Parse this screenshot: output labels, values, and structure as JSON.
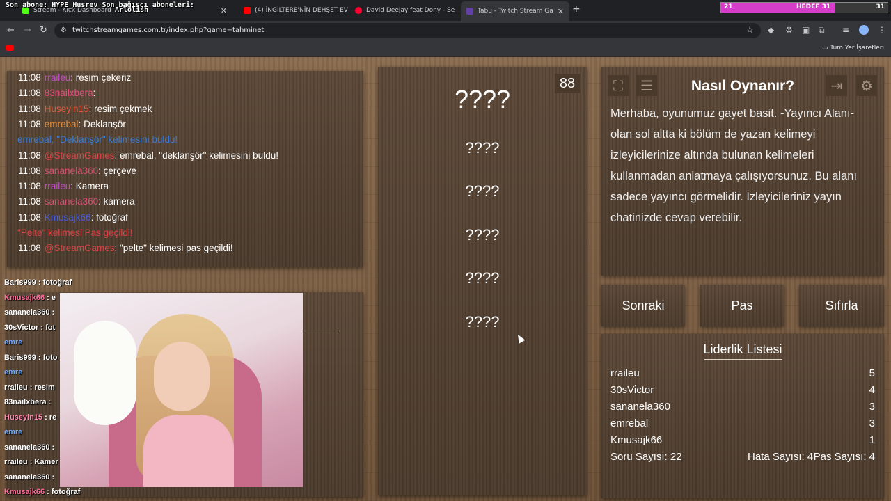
{
  "stream_overlay": {
    "sub_text": "Son abone: HYPE_Husrev Son bağışçı aboneleri:",
    "streamer_name": "Arlolish",
    "goal_left": "21",
    "goal_label": "HEDEF 31",
    "goal_right": "31",
    "goal_progress": 0.68
  },
  "tabs": [
    {
      "label": "Stream - Kick Dashboard",
      "color": "#53fc18"
    },
    {
      "label": "(4) İNGİLTERE'NİN DEHŞET EVİ",
      "color": "#ff0000"
    },
    {
      "label": "David Deejay feat Dony - Se",
      "color": "#ff0000"
    },
    {
      "label": "Tabu - Twitch Stream Game",
      "color": "#6441a5"
    }
  ],
  "address": {
    "url": "twitchstreamgames.com.tr/index.php?game=tahminet"
  },
  "bookmarks": {
    "folder_label": "Tüm Yer İşaretleri"
  },
  "chat": [
    {
      "time": "11:08",
      "user": "rraileu",
      "user_color": "#c34ecb",
      "msg": ": resim çekeriz"
    },
    {
      "time": "11:08",
      "user": "83nailxbera",
      "user_color": "#e74e7f",
      "msg": ":"
    },
    {
      "time": "11:08",
      "user": "Huseyin15",
      "user_color": "#e05a3c",
      "msg": ": resim çekmek"
    },
    {
      "time": "11:08",
      "user": "emrebal",
      "user_color": "#e08c3c",
      "msg": ": Deklanşör"
    },
    {
      "time": "",
      "user": "",
      "user_color": "#3c7bd6",
      "msg": "emrebal, \"Deklanşör\" kelimesini buldu!"
    },
    {
      "time": "11:08",
      "user": "@StreamGames",
      "user_color": "#d94444",
      "msg": ": emrebal, \"deklanşör\" kelimesini buldu!"
    },
    {
      "time": "11:08",
      "user": "sananela360",
      "user_color": "#d64f72",
      "msg": ": çerçeve"
    },
    {
      "time": "11:08",
      "user": "rraileu",
      "user_color": "#c34ecb",
      "msg": ": Kamera"
    },
    {
      "time": "11:08",
      "user": "sananela360",
      "user_color": "#d64f72",
      "msg": ": kamera"
    },
    {
      "time": "11:08",
      "user": "Kmusajk66",
      "user_color": "#4a5ed8",
      "msg": ": fotoğraf"
    },
    {
      "time": "",
      "user": "",
      "user_color": "#d94444",
      "msg": "\"Pelte\" kelimesi Pas geçildi!"
    },
    {
      "time": "11:08",
      "user": "@StreamGames",
      "user_color": "#d94444",
      "msg": ": \"pelte\" kelimesi pas geçildi!"
    }
  ],
  "overlay_chat": [
    {
      "user": "Baris999",
      "user_color": "#ffffff",
      "msg": " : fotoğraf"
    },
    {
      "user": "Kmusajk66",
      "user_color": "#ff6b9a",
      "msg": " : e"
    },
    {
      "user": "sananela360",
      "user_color": "#ffffff",
      "msg": " :"
    },
    {
      "user": "30sVictor",
      "user_color": "#ffffff",
      "msg": " : fot"
    },
    {
      "user": "emre",
      "user_color": "#6fa8ff",
      "msg": ""
    },
    {
      "user": "Baris999",
      "user_color": "#ffffff",
      "msg": " : foto"
    },
    {
      "user": "emre",
      "user_color": "#6fa8ff",
      "msg": ""
    },
    {
      "user": "rraileu",
      "user_color": "#ffffff",
      "msg": " : resim"
    },
    {
      "user": "83nailxbera",
      "user_color": "#ffffff",
      "msg": " :"
    },
    {
      "user": "Huseyin15",
      "user_color": "#ff8ab0",
      "msg": " : re"
    },
    {
      "user": "emre",
      "user_color": "#6fa8ff",
      "msg": ""
    },
    {
      "user": "sananela360",
      "user_color": "#ffffff",
      "msg": " :"
    },
    {
      "user": "rraileu",
      "user_color": "#ffffff",
      "msg": " : Kamer"
    },
    {
      "user": "sananela360",
      "user_color": "#ffffff",
      "msg": " :"
    },
    {
      "user": "Kmusajk66",
      "user_color": "#ff6b9a",
      "msg": " : fotoğraf"
    }
  ],
  "game": {
    "timer": "88",
    "main_word": "????",
    "forbidden_words": [
      "????",
      "????",
      "????",
      "????",
      "????"
    ]
  },
  "info": {
    "title": "Nasıl Oynanır?",
    "text": "Merhaba, oyunumuz gayet basit. -Yayıncı Alanı- olan sol altta ki bölüm de yazan kelimeyi izleyicilerinize altında bulunan kelimeleri kullanmadan anlatmaya çalışıyorsunuz. Bu alanı sadece yayıncı görmelidir. İzleyicileriniz yayın chatinizde cevap verebilir."
  },
  "buttons": {
    "next": "Sonraki",
    "pass": "Pas",
    "reset": "Sıfırla"
  },
  "leaderboard": {
    "title": "Liderlik Listesi",
    "rows": [
      {
        "name": "rraileu",
        "score": "5"
      },
      {
        "name": "30sVictor",
        "score": "4"
      },
      {
        "name": "sananela360",
        "score": "3"
      },
      {
        "name": "emrebal",
        "score": "3"
      },
      {
        "name": "Kmusajk66",
        "score": "1"
      }
    ],
    "question_count": "Soru Sayısı: 22",
    "error_count": "Hata Sayısı: 4",
    "pass_count": "Pas Sayısı: 4"
  }
}
